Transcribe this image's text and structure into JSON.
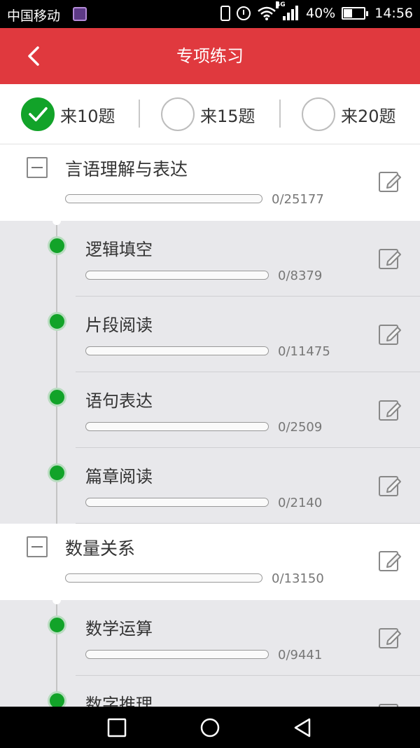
{
  "status_bar": {
    "carrier": "中国移动",
    "network": "4G",
    "battery": "40%",
    "time": "14:56"
  },
  "header": {
    "title": "专项练习",
    "back_icon": "chevron-left-icon"
  },
  "count_options": [
    {
      "label": "来10题",
      "selected": true
    },
    {
      "label": "来15题",
      "selected": false
    },
    {
      "label": "来20题",
      "selected": false
    }
  ],
  "categories": [
    {
      "name": "言语理解与表达",
      "count": "0/25177",
      "progress": 0,
      "expanded": true,
      "subs": [
        {
          "name": "逻辑填空",
          "count": "0/8379",
          "progress": 0
        },
        {
          "name": "片段阅读",
          "count": "0/11475",
          "progress": 0
        },
        {
          "name": "语句表达",
          "count": "0/2509",
          "progress": 0
        },
        {
          "name": "篇章阅读",
          "count": "0/2140",
          "progress": 0
        }
      ]
    },
    {
      "name": "数量关系",
      "count": "0/13150",
      "progress": 0,
      "expanded": true,
      "subs": [
        {
          "name": "数学运算",
          "count": "0/9441",
          "progress": 0
        },
        {
          "name": "数字推理",
          "count": "",
          "progress": 0
        }
      ]
    }
  ],
  "colors": {
    "header": "#e0393e",
    "accent": "#12a329"
  },
  "nav_icons": [
    "recent-apps-icon",
    "home-icon",
    "back-icon"
  ]
}
